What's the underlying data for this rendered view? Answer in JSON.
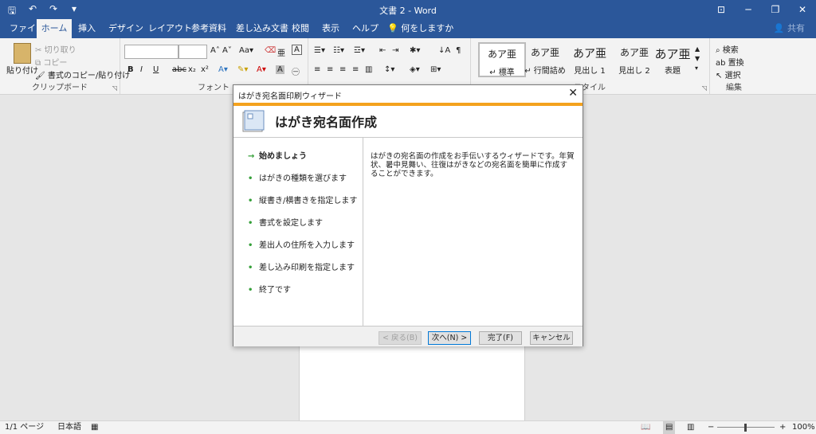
{
  "window": {
    "title": "文書 2 - Word",
    "qat": [
      "🖫",
      "↶",
      "↷",
      "▾"
    ],
    "controls": [
      "⊡",
      "─",
      "❐",
      "✕"
    ]
  },
  "tabs": [
    "ファイル",
    "ホーム",
    "挿入",
    "デザイン",
    "レイアウト",
    "参考資料",
    "差し込み文書",
    "校閲",
    "表示",
    "ヘルプ"
  ],
  "tellme": "何をしますか",
  "share": "共有",
  "ribbon": {
    "clipboard": {
      "label": "クリップボード",
      "paste": "貼り付け",
      "cut": "切り取り",
      "copy": "コピー",
      "format_painter": "書式のコピー/貼り付け"
    },
    "font": {
      "label": "フォント",
      "buttons": [
        "B",
        "I",
        "U",
        "abc",
        "x₂",
        "x²"
      ]
    },
    "styles": {
      "label": "スタイル",
      "items": [
        {
          "preview": "あア亜",
          "label": "↵ 標準"
        },
        {
          "preview": "あア亜",
          "label": "↵ 行間詰め"
        },
        {
          "preview": "あア亜",
          "label": "見出し 1"
        },
        {
          "preview": "あア亜",
          "label": "見出し 2"
        },
        {
          "preview": "あア亜",
          "label": "表題"
        }
      ]
    },
    "editing": {
      "label": "編集",
      "find": "検索",
      "replace": "置換",
      "select": "選択"
    }
  },
  "dialog": {
    "title": "はがき宛名面印刷ウィザード",
    "header": "はがき宛名面作成",
    "steps": [
      {
        "label": "始めましょう",
        "current": true
      },
      {
        "label": "はがきの種類を選びます",
        "current": false
      },
      {
        "label": "縦書き/横書きを指定します",
        "current": false
      },
      {
        "label": "書式を設定します",
        "current": false
      },
      {
        "label": "差出人の住所を入力します",
        "current": false
      },
      {
        "label": "差し込み印刷を指定します",
        "current": false
      },
      {
        "label": "終了です",
        "current": false
      }
    ],
    "description": "はがきの宛名面の作成をお手伝いするウィザードです。年賀状、暑中見舞い、往復はがきなどの宛名面を簡単に作成することができます。",
    "buttons": {
      "back": "< 戻る(B)",
      "next": "次へ(N) >",
      "finish": "完了(F)",
      "cancel": "キャンセル"
    }
  },
  "status": {
    "page": "1/1 ページ",
    "language": "日本語",
    "zoom": "100%"
  }
}
